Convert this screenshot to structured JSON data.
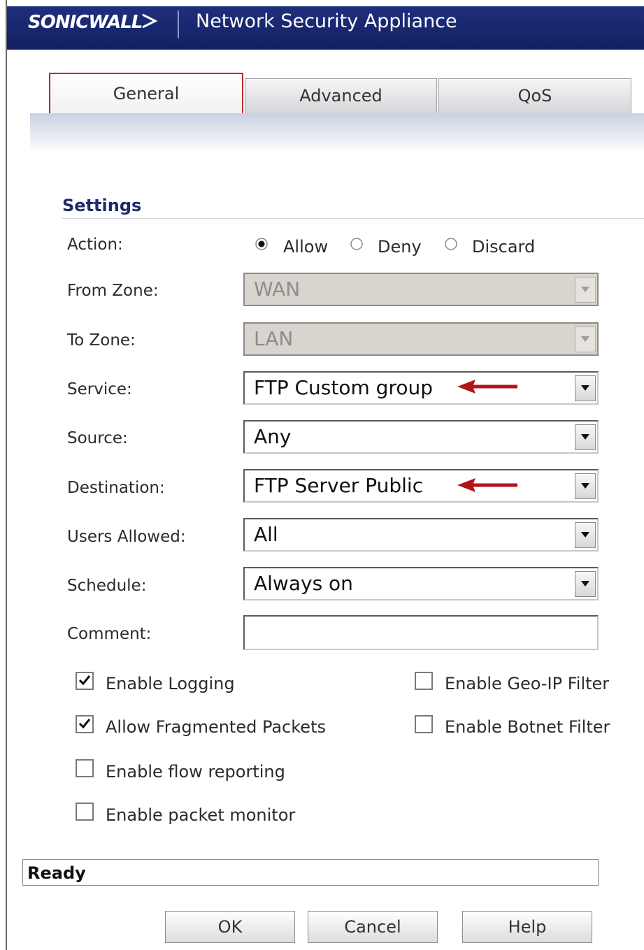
{
  "header": {
    "brand": "SONICWALL",
    "title": "Network Security Appliance"
  },
  "tabs": [
    {
      "label": "General",
      "active": true
    },
    {
      "label": "Advanced",
      "active": false
    },
    {
      "label": "QoS",
      "active": false
    }
  ],
  "settings": {
    "title": "Settings",
    "action": {
      "label": "Action:",
      "options": [
        "Allow",
        "Deny",
        "Discard"
      ],
      "selected": "Allow"
    },
    "from_zone": {
      "label": "From Zone:",
      "value": "WAN",
      "disabled": true
    },
    "to_zone": {
      "label": "To Zone:",
      "value": "LAN",
      "disabled": true
    },
    "service": {
      "label": "Service:",
      "value": "FTP Custom group"
    },
    "source": {
      "label": "Source:",
      "value": "Any"
    },
    "destination": {
      "label": "Destination:",
      "value": "FTP Server Public"
    },
    "users_allowed": {
      "label": "Users Allowed:",
      "value": "All"
    },
    "schedule": {
      "label": "Schedule:",
      "value": "Always on"
    },
    "comment": {
      "label": "Comment:",
      "value": ""
    }
  },
  "checkboxes": {
    "enable_logging": {
      "label": "Enable Logging",
      "checked": true
    },
    "allow_fragmented": {
      "label": "Allow Fragmented Packets",
      "checked": true
    },
    "enable_flow_reporting": {
      "label": "Enable flow reporting",
      "checked": false
    },
    "enable_packet_monitor": {
      "label": "Enable packet monitor",
      "checked": false
    },
    "enable_geo_ip": {
      "label": "Enable Geo-IP Filter",
      "checked": false
    },
    "enable_botnet": {
      "label": "Enable Botnet Filter",
      "checked": false
    }
  },
  "status": "Ready",
  "buttons": {
    "ok": "OK",
    "cancel": "Cancel",
    "help": "Help"
  },
  "colors": {
    "header_bg": "#1f2f7c",
    "active_tab_border": "#c0282b",
    "annotation_arrow": "#b3141a"
  }
}
